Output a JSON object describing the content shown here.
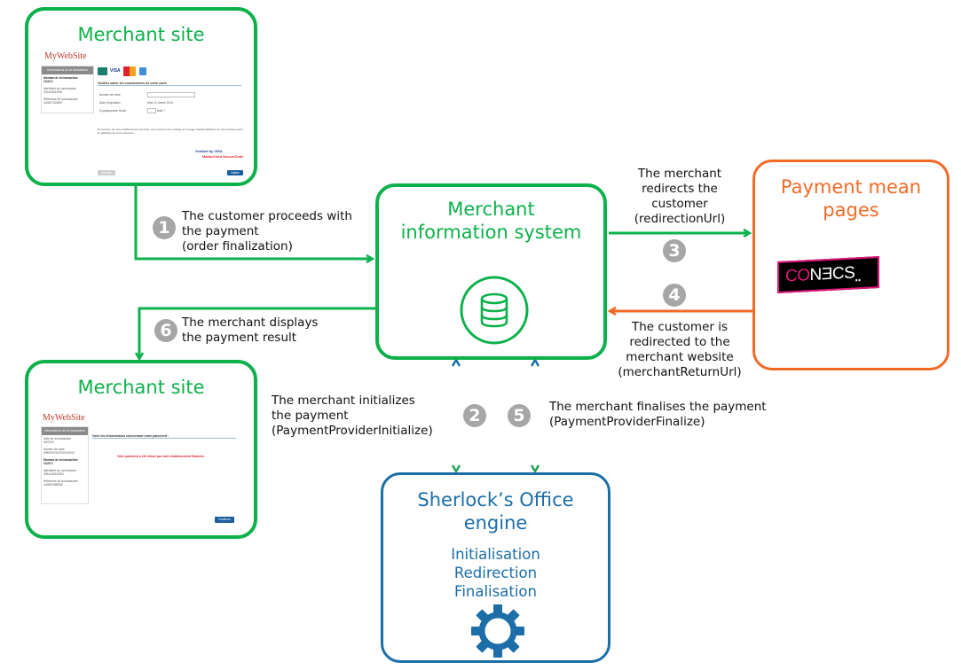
{
  "colors": {
    "merchant_green": "#0db14b",
    "payment_orange": "#f26a25",
    "engine_blue": "#1b6ea8",
    "step_grey": "#a6a6a6",
    "conecs_pink": "#e0177a"
  },
  "nodes": {
    "merchant_site_top": {
      "title": "Merchant site",
      "mini": {
        "logo": "MyWebSite",
        "sidebar_header": "Informations de la transaction",
        "sidebar_items": [
          {
            "label": "Montant de la transaction",
            "value": "10,00 €",
            "bold": true
          },
          {
            "label": "Identifiant du commerçant",
            "value": "001444342901",
            "bold": false
          },
          {
            "label": "Référence de la transaction",
            "value": "1408C7404I90",
            "bold": false
          }
        ],
        "card_brands": [
          "CB",
          "VISA",
          "MasterCard",
          "AMEX"
        ],
        "form_heading": "Veuillez saisir les coordonnées de votre carte",
        "fields": [
          {
            "label": "Numéro de carte",
            "value": ""
          },
          {
            "label": "Date d'expiration",
            "value": "Mois 11  Année 2014"
          },
          {
            "label": "Cryptogramme visuel",
            "value": "Aide ?"
          }
        ],
        "notice": "En fonction de votre établissement bancaire, vous pourrez être redirigé sur la page d'authentification de votre banque avant la validation de votre paiement.",
        "secure_badges": [
          "Verified by VISA",
          "MasterCard SecureCode"
        ],
        "cancel_button": "Annuler",
        "submit_button": "Valider"
      }
    },
    "merchant_site_bottom": {
      "title": "Merchant site",
      "mini": {
        "logo": "MyWebSite",
        "sidebar_header": "Informations de la transaction",
        "sidebar_items": [
          {
            "label": "Date de la transaction",
            "value": "04/2014",
            "bold": false
          },
          {
            "label": "Numéro de carte",
            "value": "4999XXXXXXXXXX0021",
            "bold": false
          },
          {
            "label": "Montant de la transaction",
            "value": "10,00 €",
            "bold": true
          },
          {
            "label": "Identifiant du commerçant",
            "value": "0094442342901",
            "bold": false
          },
          {
            "label": "Référence de la transaction",
            "value": "1408E2868968",
            "bold": false
          }
        ],
        "result_heading": "Voici les informations concernant votre paiement :",
        "result_message": "Votre paiement a été refusé par votre établissement financier.",
        "continue_button": "Continuer"
      }
    },
    "merchant_is": {
      "title_line1": "Merchant",
      "title_line2": "information system",
      "icon": "database-icon"
    },
    "payment_mean": {
      "title_line1": "Payment mean",
      "title_line2": "pages",
      "logo_text_pink": "CO",
      "logo_text_white": "NƎCS",
      "logo_dots": ".."
    },
    "engine": {
      "title_line1": "Sherlock’s Office",
      "title_line2": "engine",
      "functions": [
        "Initialisation",
        "Redirection",
        "Finalisation"
      ],
      "icon": "gear-icon"
    }
  },
  "steps": [
    {
      "number": "1",
      "lines": [
        "The customer proceeds with",
        "the payment",
        "(order finalization)"
      ]
    },
    {
      "number": "2",
      "lines": [
        "The merchant initializes",
        "the payment",
        "(PaymentProviderInitialize)"
      ]
    },
    {
      "number": "3",
      "lines": [
        "The merchant",
        "redirects the",
        "customer",
        "(redirectionUrl)"
      ]
    },
    {
      "number": "4",
      "lines": [
        "The customer is",
        "redirected to the",
        "merchant website",
        "(merchantReturnUrl)"
      ]
    },
    {
      "number": "5",
      "lines": [
        "The merchant finalises the payment",
        "(PaymentProviderFinalize)"
      ]
    },
    {
      "number": "6",
      "lines": [
        "The merchant displays",
        "the payment result"
      ]
    }
  ]
}
